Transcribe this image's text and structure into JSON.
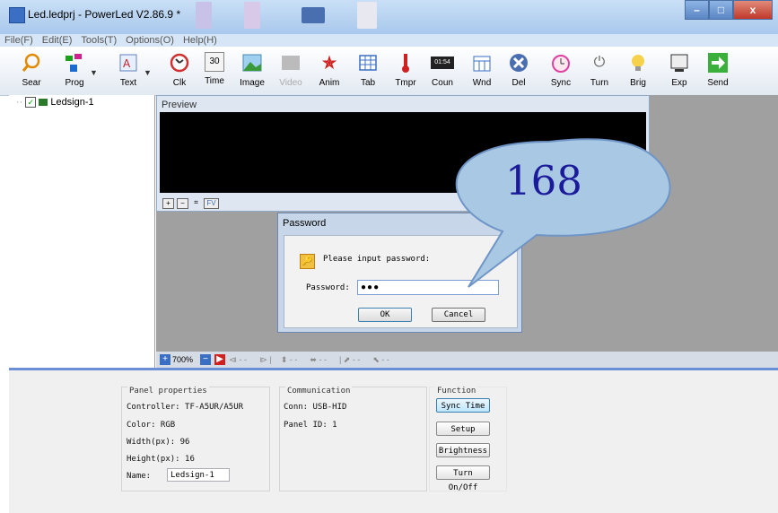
{
  "window": {
    "title": "Led.ledprj - PowerLed V2.86.9 *",
    "controls": {
      "minimize": "–",
      "maximize": "□",
      "close": "x"
    }
  },
  "menu": [
    "File(F)",
    "Edit(E)",
    "Tools(T)",
    "Options(O)",
    "Help(H)"
  ],
  "toolbar": [
    {
      "label": "Sear",
      "icon": "search-icon"
    },
    {
      "label": "Prog",
      "icon": "program-icon"
    },
    {
      "label": "Text",
      "icon": "text-icon"
    },
    {
      "label": "Clk",
      "icon": "clock-icon"
    },
    {
      "label": "Time",
      "icon": "calendar-icon",
      "glyph": "30"
    },
    {
      "label": "Image",
      "icon": "image-icon"
    },
    {
      "label": "Video",
      "icon": "video-icon"
    },
    {
      "label": "Anim",
      "icon": "animation-icon"
    },
    {
      "label": "Tab",
      "icon": "table-icon"
    },
    {
      "label": "Tmpr",
      "icon": "thermometer-icon"
    },
    {
      "label": "Coun",
      "icon": "counter-icon",
      "glyph": "01:54"
    },
    {
      "label": "Wnd",
      "icon": "window-icon"
    },
    {
      "label": "Del",
      "icon": "delete-icon"
    },
    {
      "label": "Sync",
      "icon": "alarm-clock-icon"
    },
    {
      "label": "Turn",
      "icon": "power-icon"
    },
    {
      "label": "Brig",
      "icon": "bulb-icon"
    },
    {
      "label": "Exp",
      "icon": "export-icon"
    },
    {
      "label": "Send",
      "icon": "send-arrow-icon"
    }
  ],
  "tree": {
    "node": "Ledsign-1"
  },
  "preview": {
    "title": "Preview"
  },
  "zoom": "700%",
  "panel": {
    "title": "Panel properties",
    "controller": "Controller: TF-A5UR/A5UR",
    "color": "Color: RGB",
    "width": "Width(px): 96",
    "height": "Height(px): 16",
    "name_label": "Name:",
    "name_value": "Ledsign-1"
  },
  "communication": {
    "title": "Communication",
    "conn": "Conn: USB-HID",
    "panel_id": "Panel ID: 1"
  },
  "function": {
    "title": "Function",
    "buttons": [
      "Sync Time",
      "Setup",
      "Brightness",
      "Turn On/Off"
    ]
  },
  "dialog": {
    "title": "Password",
    "message": "Please input password:",
    "label": "Password:",
    "value": "●●●",
    "ok": "OK",
    "cancel": "Cancel"
  },
  "callout": {
    "text": "168"
  },
  "colors": {
    "accent": "#6a8fd6",
    "bubble": "#a9c8e3",
    "bubble_text": "#1a1a9a"
  }
}
